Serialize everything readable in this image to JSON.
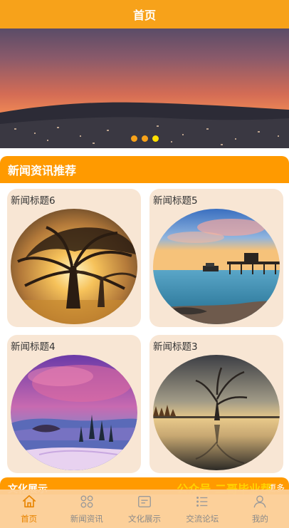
{
  "header": {
    "title": "首页"
  },
  "banner": {
    "dot_count": 3,
    "active_dot": 2
  },
  "news_section": {
    "title": "新闻资讯推荐"
  },
  "news_cards": [
    {
      "title": "新闻标题6",
      "image": "sunset-tree"
    },
    {
      "title": "新闻标题5",
      "image": "lake-pier"
    },
    {
      "title": "新闻标题4",
      "image": "purple-lake"
    },
    {
      "title": "新闻标题3",
      "image": "lone-tree-reflection"
    }
  ],
  "next_section": {
    "title": "文化展示",
    "more": "更多"
  },
  "watermark": "公众号 二哥毕业帮",
  "tabbar": {
    "items": [
      {
        "label": "首页",
        "icon": "home-icon",
        "active": true
      },
      {
        "label": "新闻资讯",
        "icon": "grid-icon",
        "active": false
      },
      {
        "label": "文化展示",
        "icon": "image-icon",
        "active": false
      },
      {
        "label": "交流论坛",
        "icon": "list-icon",
        "active": false
      },
      {
        "label": "我的",
        "icon": "person-icon",
        "active": false
      }
    ]
  },
  "colors": {
    "primary": "#f7a21a",
    "section": "#ff9a00",
    "card_bg": "#f8e6d4",
    "active_tab": "#e88400"
  }
}
